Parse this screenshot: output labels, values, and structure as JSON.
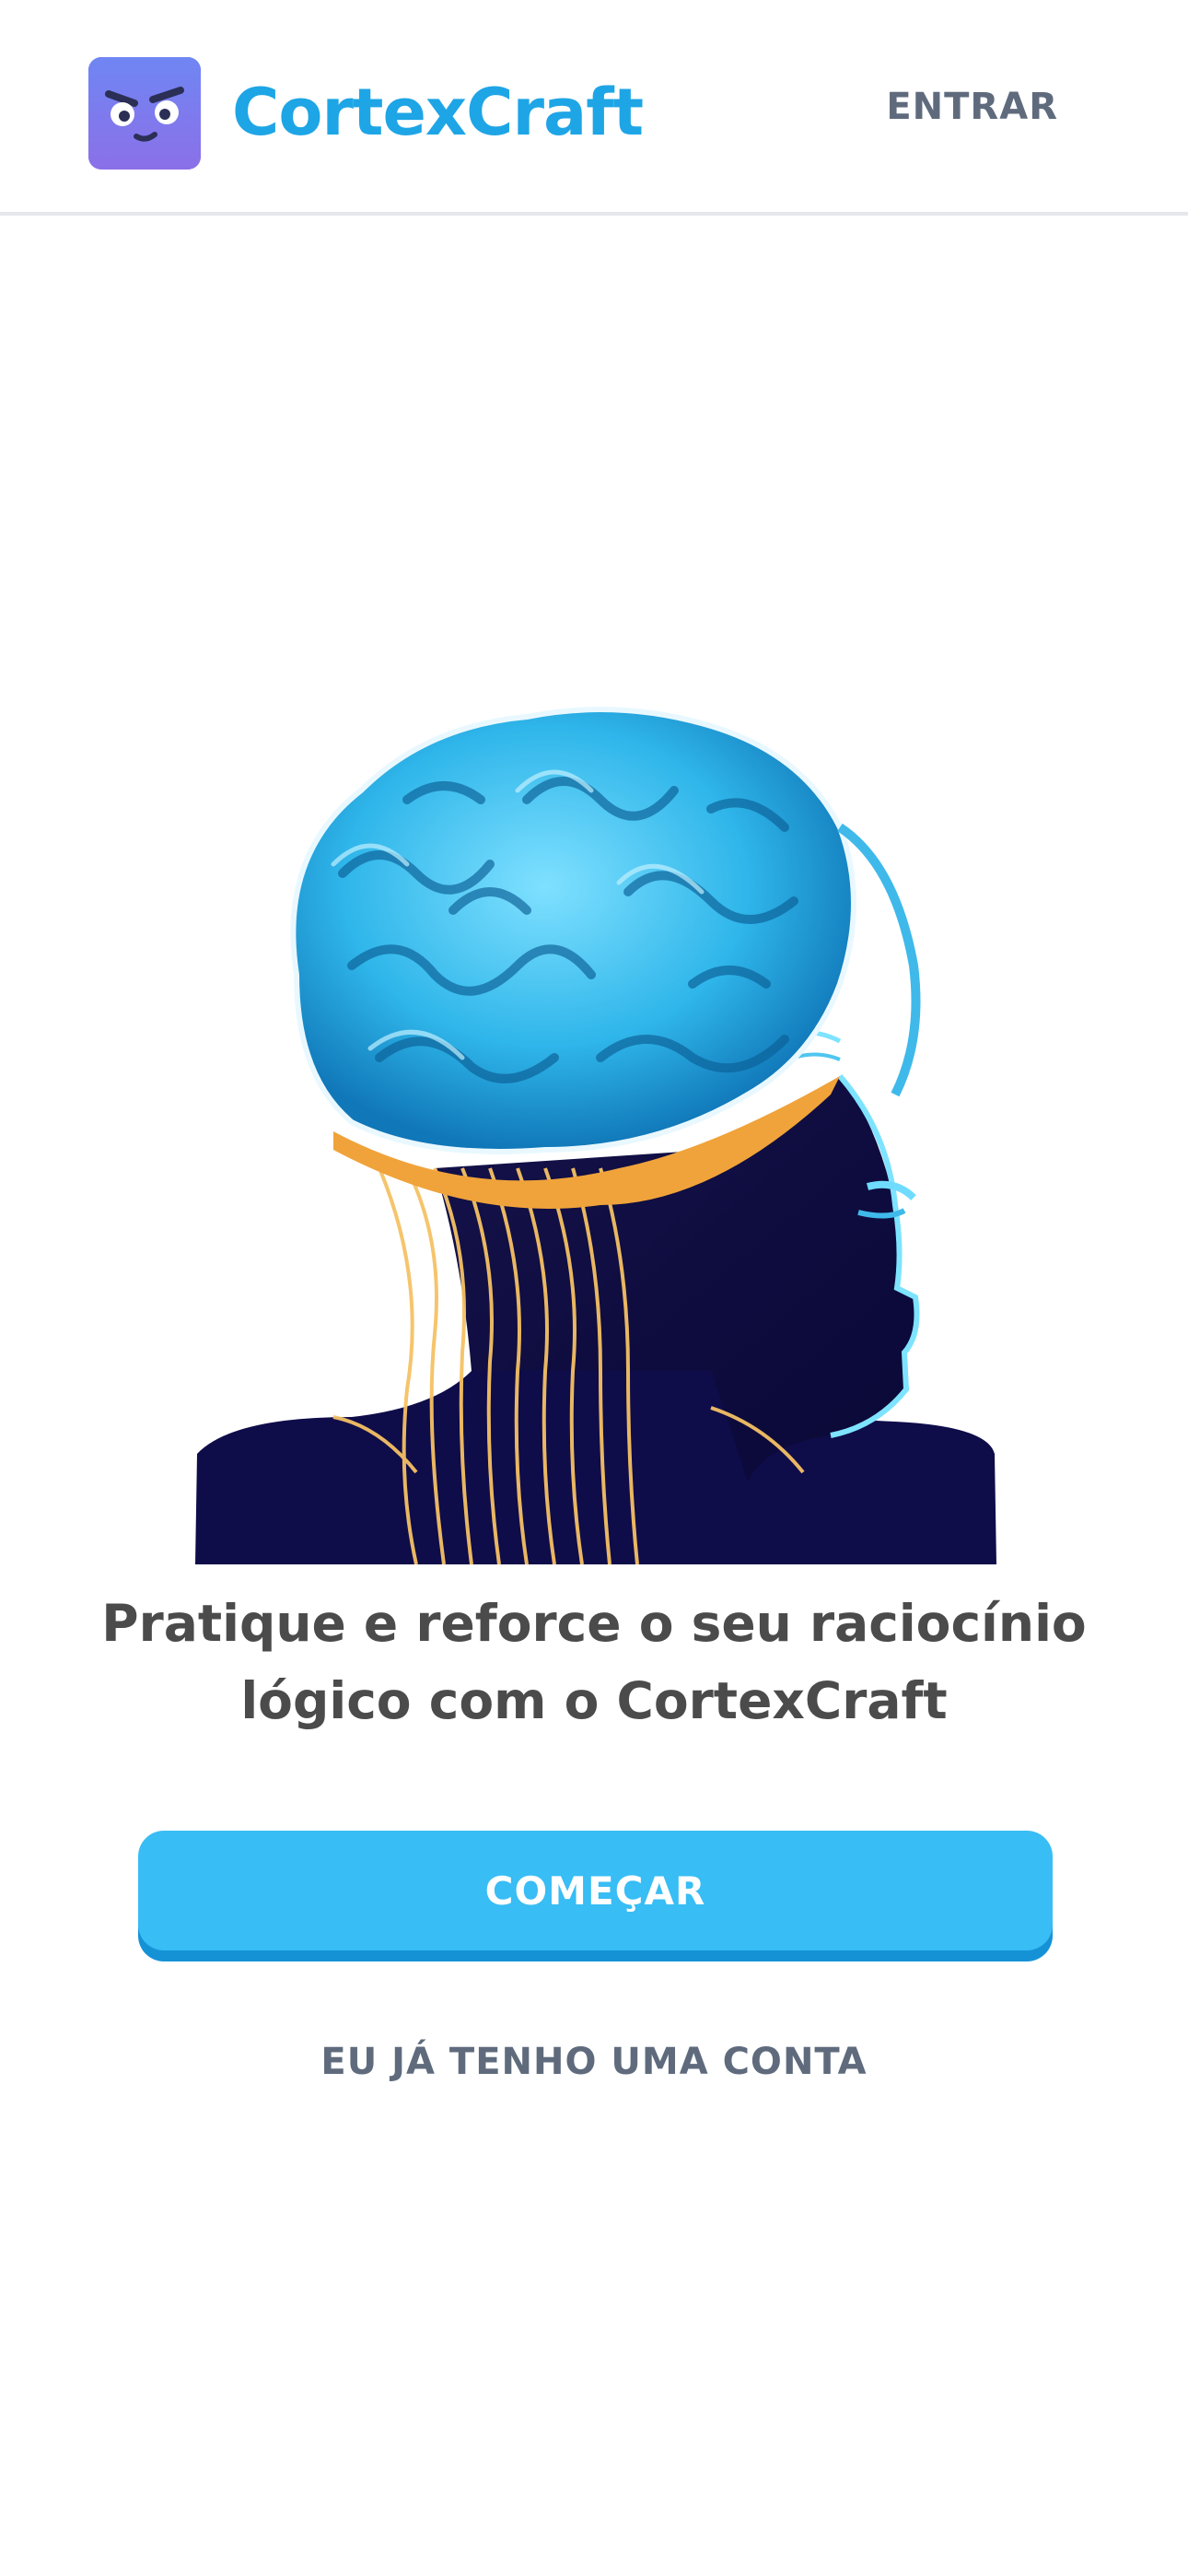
{
  "header": {
    "brand_name": "CortexCraft",
    "login_label": "ENTRAR",
    "logo_icon": "angry-face-cube-icon"
  },
  "hero": {
    "image": "brain-head-illustration"
  },
  "main": {
    "headline": "Pratique e reforce o seu raciocínio lógico com o CortexCraft",
    "start_label": "COMEÇAR",
    "account_label": "EU JÁ TENHO UMA CONTA"
  },
  "colors": {
    "brand": "#1ea5e6",
    "button": "#38bdf5",
    "button_shadow": "#1592d6",
    "text_dark": "#4b4b4b",
    "text_muted": "#5f6b7d"
  }
}
